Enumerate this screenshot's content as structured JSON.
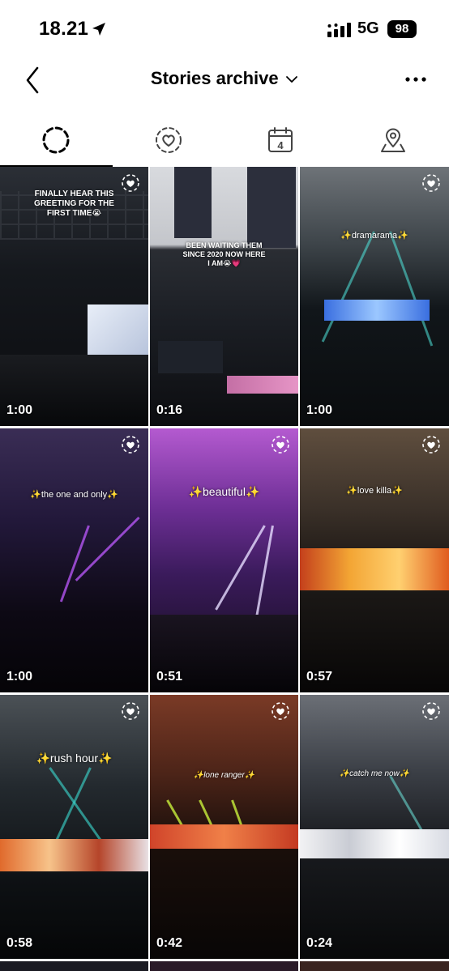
{
  "status": {
    "time": "18.21",
    "network": "5G",
    "battery": "98"
  },
  "header": {
    "title": "Stories archive"
  },
  "tabs": [
    {
      "name": "stories",
      "icon": "stories-ring-icon"
    },
    {
      "name": "highlights",
      "icon": "heart-ring-icon"
    },
    {
      "name": "calendar",
      "icon": "calendar-icon",
      "day": "4"
    },
    {
      "name": "map",
      "icon": "map-pin-icon"
    }
  ],
  "tiles": [
    {
      "caption": "FINALLY HEAR THIS GREETING FOR THE FIRST TIME😭",
      "duration": "1:00"
    },
    {
      "caption": "BEEN WAITING THEM SINCE 2020 NOW HERE I AM😭💗",
      "duration": "0:16"
    },
    {
      "caption": "✨dramarama✨",
      "duration": "1:00"
    },
    {
      "caption": "✨the one and only✨",
      "duration": "1:00"
    },
    {
      "caption": "✨beautiful✨",
      "duration": "0:51"
    },
    {
      "caption": "✨love killa✨",
      "duration": "0:57"
    },
    {
      "caption": "✨rush hour✨",
      "duration": "0:58"
    },
    {
      "caption": "✨lone ranger✨",
      "duration": "0:42"
    },
    {
      "caption": "✨catch me now✨",
      "duration": "0:24"
    }
  ],
  "colors": {
    "accent": "#000000",
    "background": "#ffffff"
  }
}
